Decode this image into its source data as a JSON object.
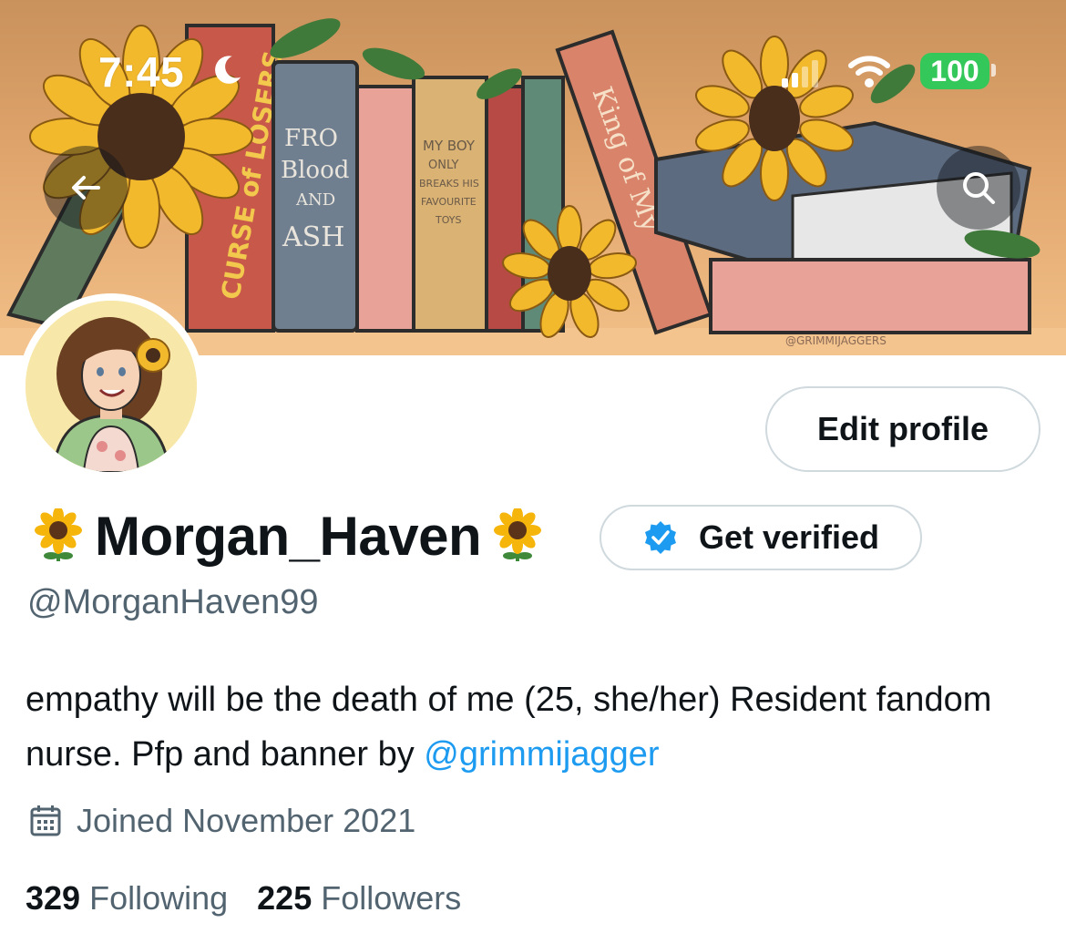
{
  "status_bar": {
    "time": "7:45",
    "battery": "100",
    "icons": [
      "moon-icon",
      "signal-icon",
      "wifi-icon",
      "battery-icon"
    ]
  },
  "banner": {
    "description_icons": [
      "back-arrow-icon",
      "search-icon"
    ],
    "artist_watermark": "@GRIMMIJAGGERS",
    "book_spine_texts": [
      "From Blood and Ash",
      "My Boy Only Breaks His Favourite Toys",
      "King of My"
    ]
  },
  "profile": {
    "display_name": "Morgan_Haven",
    "name_emoji": "sunflower-icon",
    "handle": "@MorganHaven99",
    "bio_text": "empathy will be the death of me (25, she/her) Resident fandom nurse. Pfp and banner by ",
    "bio_mention": "@grimmijagger",
    "joined": "Joined November 2021",
    "following_count": "329",
    "following_label": "Following",
    "followers_count": "225",
    "followers_label": "Followers"
  },
  "buttons": {
    "edit_profile": "Edit profile",
    "get_verified": "Get verified"
  },
  "colors": {
    "accent": "#1d9bf0",
    "secondary_text": "#536471",
    "border": "#cfd9de",
    "battery_green": "#34c759"
  }
}
